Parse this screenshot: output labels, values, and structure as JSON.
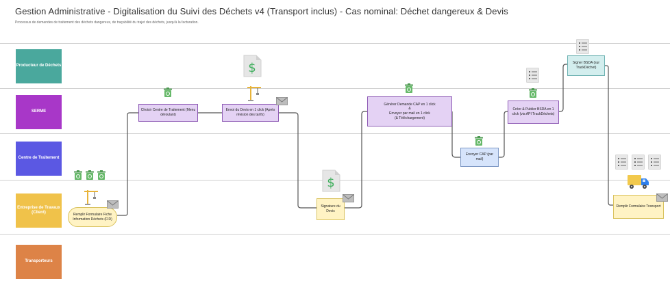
{
  "header": {
    "title": "Gestion Administrative - Digitalisation du Suivi des Déchets v4 (Transport inclus) - Cas nominal: Déchet dangereux & Devis",
    "subtitle": "Processus de demandes de traitement des déchets dangereux, de traçabilité du trajet des déchets, jusqu'à la facturation."
  },
  "lanes": [
    {
      "label": "Producteur de Déchets",
      "color": "#4aa89d"
    },
    {
      "label": "SERME",
      "color": "#a837c8"
    },
    {
      "label": "Centre de Traitement",
      "color": "#5b58e3"
    },
    {
      "label": "Entreprise de Travaux (Client)",
      "color": "#f0c24a"
    },
    {
      "label": "Transporteurs",
      "color": "#dd8347"
    }
  ],
  "nodes": {
    "fid": "Remplir Formulaire Fiche Information Déchets (FID)",
    "choisir": "Choisir Centre de Traitement (Menu déroulant)",
    "envoi_devis": "Envoi du Devis en 1 click (Après révision des tarifs)",
    "signature": "Signature du Devis",
    "cap": "Générer Demande CAP en 1 click\n&\nEnvoyer par mail en 1 click\n(& Téléchargement)",
    "envoyer_cap": "Envoyer CAP (par mail)",
    "bsda": "Créer & Publier BSDA en 1 click (via API TrackDéchets)",
    "signer_bsda": "Signer BSDA (sur TrackDéchet)",
    "transport": "Remplir Formulaire Transport"
  },
  "colors": {
    "purple_node": "#e4d2f4",
    "blue_node": "#d6e4fb",
    "yellow_node": "#fff3c4",
    "teal_node": "#d3eeee",
    "trash_green": "#67b96a",
    "dollar_green": "#3fae5d",
    "truck_yellow": "#f2c94c",
    "truck_blue": "#2f80ed",
    "crane_yellow": "#e8b43a"
  },
  "icons": [
    "trash-icon",
    "dollar-document-icon",
    "crane-icon",
    "mail-icon",
    "list-document-icon",
    "truck-icon"
  ]
}
